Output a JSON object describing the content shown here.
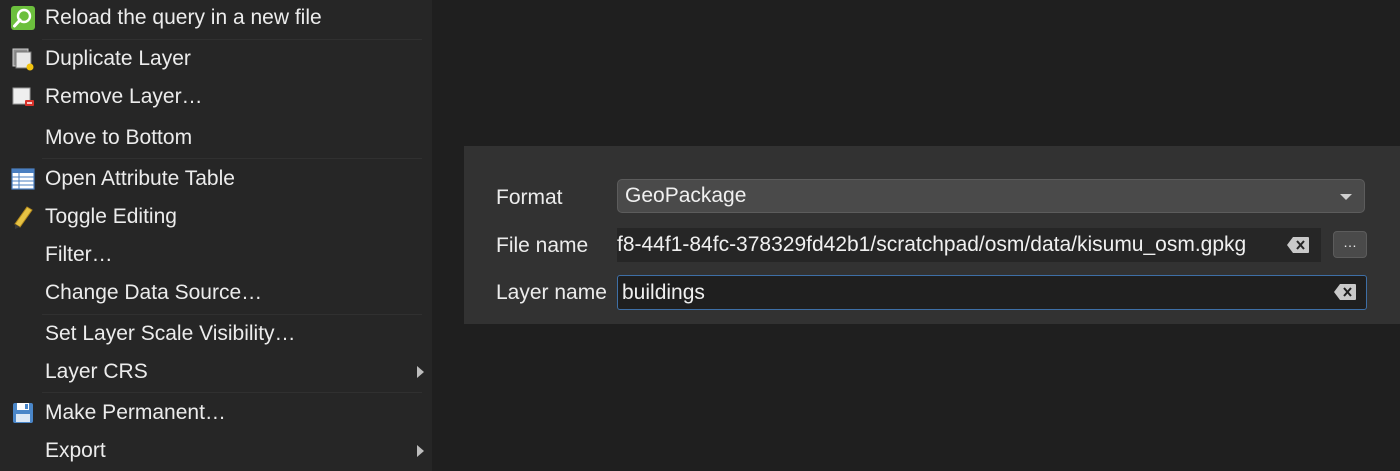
{
  "context_menu": {
    "items": [
      {
        "label": "Reload the query in a new file",
        "icon": "search-reload-icon"
      },
      {
        "label": "Duplicate Layer",
        "icon": "duplicate-layer-icon"
      },
      {
        "label": "Remove Layer…",
        "icon": "remove-layer-icon"
      },
      {
        "label": "Move to Bottom",
        "icon": ""
      },
      {
        "label": "Open Attribute Table",
        "icon": "attribute-table-icon"
      },
      {
        "label": "Toggle Editing",
        "icon": "pencil-icon"
      },
      {
        "label": "Filter…",
        "icon": ""
      },
      {
        "label": "Change Data Source…",
        "icon": ""
      },
      {
        "label": "Set Layer Scale Visibility…",
        "icon": ""
      },
      {
        "label": "Layer CRS",
        "icon": "",
        "submenu": true
      },
      {
        "label": "Make Permanent…",
        "icon": "save-icon"
      },
      {
        "label": "Export",
        "icon": "",
        "submenu": true
      }
    ]
  },
  "save_dialog": {
    "format_label": "Format",
    "format_value": "GeoPackage",
    "file_name_label": "File name",
    "file_name_value": "f8-44f1-84fc-378329fd42b1/scratchpad/osm/data/kisumu_osm.gpkg",
    "browse_label": "…",
    "layer_name_label": "Layer name",
    "layer_name_value": "buildings"
  },
  "colors": {
    "menu_background": "#262626",
    "panel_background": "#323232",
    "focus_border": "#3e6fa6"
  }
}
